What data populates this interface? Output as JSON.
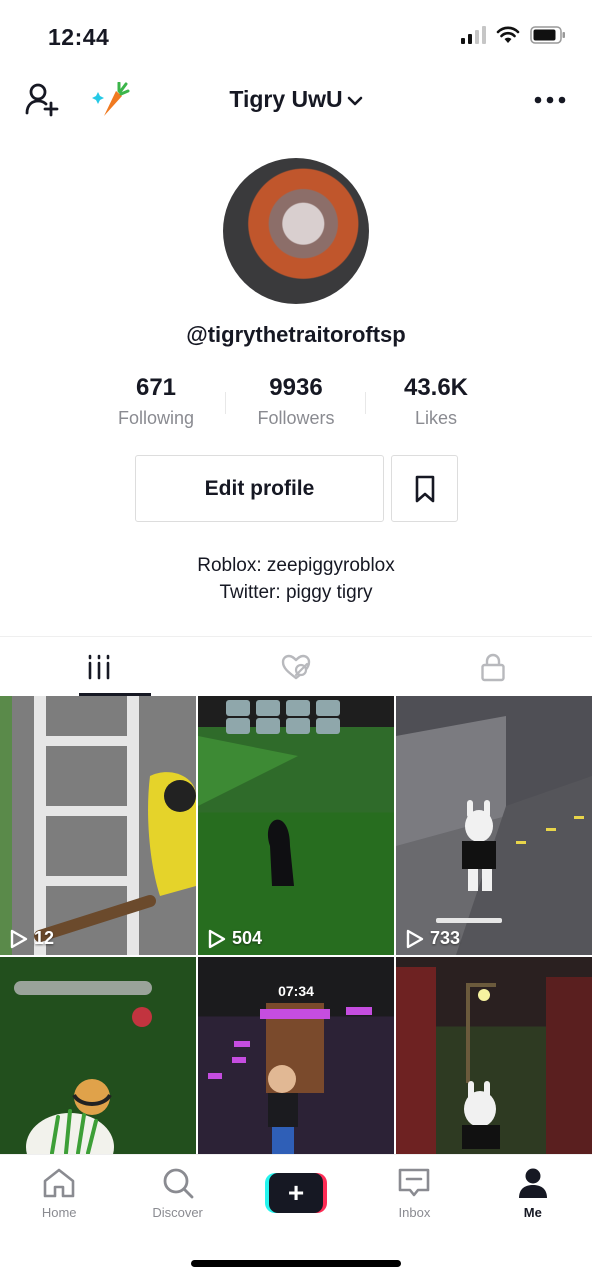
{
  "status_bar": {
    "time": "12:44"
  },
  "header": {
    "title": "Tigry UwU"
  },
  "profile": {
    "username": "@tigrythetraitoroftsp",
    "stats": [
      {
        "value": "671",
        "label": "Following"
      },
      {
        "value": "9936",
        "label": "Followers"
      },
      {
        "value": "43.6K",
        "label": "Likes"
      }
    ],
    "edit_label": "Edit profile",
    "bio_lines": [
      "Roblox: zeepiggyroblox",
      "Twitter: piggy tigry"
    ]
  },
  "videos": [
    {
      "views": "12"
    },
    {
      "views": "504"
    },
    {
      "views": "733"
    },
    {
      "views": ""
    },
    {
      "timestamp": "07:34"
    },
    {
      "views": ""
    }
  ],
  "bottom_nav": {
    "items": [
      {
        "label": "Home",
        "icon": "home-icon"
      },
      {
        "label": "Discover",
        "icon": "search-icon"
      },
      {
        "label": "",
        "icon": "plus-icon"
      },
      {
        "label": "Inbox",
        "icon": "inbox-icon"
      },
      {
        "label": "Me",
        "icon": "person-icon"
      }
    ]
  },
  "colors": {
    "accent_cyan": "#25f4ee",
    "accent_red": "#fe2c55",
    "text": "#161823",
    "muted": "#8a8b91"
  }
}
